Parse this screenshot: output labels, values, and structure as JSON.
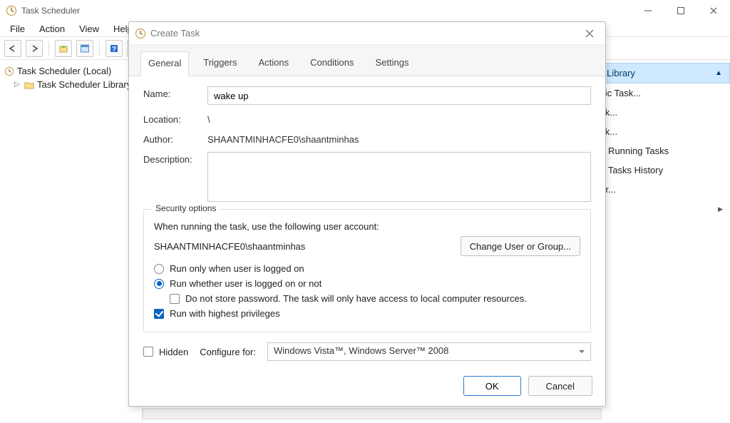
{
  "main": {
    "title": "Task Scheduler",
    "menu": {
      "file": "File",
      "action": "Action",
      "view": "View",
      "help": "Help"
    },
    "tree": {
      "root": "Task Scheduler (Local)",
      "lib": "Task Scheduler Library"
    },
    "actions": {
      "header": "er Library",
      "items": {
        "basic": "asic Task...",
        "task": "ask...",
        "import": "ask...",
        "running": "All Running Tasks",
        "history": "All Tasks History",
        "folder": "der..."
      }
    }
  },
  "dialog": {
    "title": "Create Task",
    "tabs": {
      "general": "General",
      "triggers": "Triggers",
      "actions": "Actions",
      "conditions": "Conditions",
      "settings": "Settings"
    },
    "form": {
      "name_label": "Name:",
      "name_value": "wake up",
      "location_label": "Location:",
      "location_value": "\\",
      "author_label": "Author:",
      "author_value": "SHAANTMINHACFE0\\shaantminhas",
      "description_label": "Description:"
    },
    "security": {
      "legend": "Security options",
      "run_as_label": "When running the task, use the following user account:",
      "account": "SHAANTMINHACFE0\\shaantminhas",
      "change_btn": "Change User or Group...",
      "radio_logged_on": "Run only when user is logged on",
      "radio_whether": "Run whether user is logged on or not",
      "chk_nopass": "Do not store password.  The task will only have access to local computer resources.",
      "chk_highest": "Run with highest privileges"
    },
    "bottom": {
      "hidden": "Hidden",
      "configure_for_label": "Configure for:",
      "configure_for_value": "Windows Vista™, Windows Server™ 2008"
    },
    "buttons": {
      "ok": "OK",
      "cancel": "Cancel"
    }
  }
}
